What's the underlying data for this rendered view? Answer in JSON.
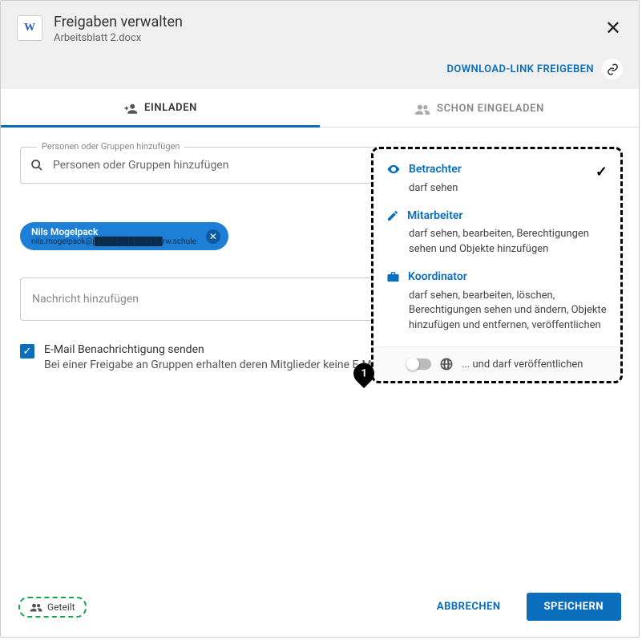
{
  "header": {
    "title": "Freigaben verwalten",
    "filename": "Arbeitsblatt 2.docx"
  },
  "download_link_label": "DOWNLOAD-LINK FREIGEBEN",
  "tabs": {
    "invite": "EINLADEN",
    "invited": "SCHON EINGELADEN"
  },
  "search": {
    "floating_label": "Personen oder Gruppen hinzufügen",
    "placeholder": "Personen oder Gruppen hinzufügen"
  },
  "chip": {
    "name": "Nils Mogelpack",
    "email": "nils.mogelpack@j████████████rw.schule"
  },
  "message_placeholder": "Nachricht hinzufügen",
  "notify": {
    "label": "E-Mail Benachrichtigung senden",
    "hint": "Bei einer Freigabe an Gruppen erhalten deren Mitglieder keine E-M"
  },
  "roles": {
    "viewer": {
      "title": "Betrachter",
      "desc": "darf sehen"
    },
    "editor": {
      "title": "Mitarbeiter",
      "desc": "darf sehen, bearbeiten, Berechtigungen sehen und Objekte hinzufügen"
    },
    "coord": {
      "title": "Koordinator",
      "desc": "darf sehen, bearbeiten, löschen, Berechtigungen sehen und ändern, Objekte hinzufügen und entfernen, veröffentlichen"
    },
    "publish": "... und darf veröffentlichen"
  },
  "callout_number": "1",
  "shared_label": "Geteilt",
  "actions": {
    "cancel": "ABBRECHEN",
    "save": "SPEICHERN"
  }
}
